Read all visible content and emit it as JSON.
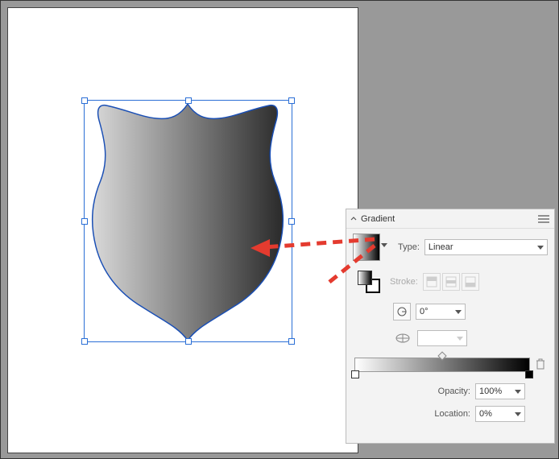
{
  "panel": {
    "title": "Gradient",
    "type_label": "Type:",
    "type_value": "Linear",
    "stroke_label": "Stroke:",
    "angle_value": "0°",
    "opacity_label": "Opacity:",
    "opacity_value": "100%",
    "location_label": "Location:",
    "location_value": "0%"
  },
  "gradient": {
    "start_color": "#ffffff",
    "end_color": "#000000",
    "midpoint": 50
  },
  "icons": {
    "chevron_double_left": "chevron-double-left-icon",
    "close": "close-icon",
    "menu": "menu-icon"
  }
}
